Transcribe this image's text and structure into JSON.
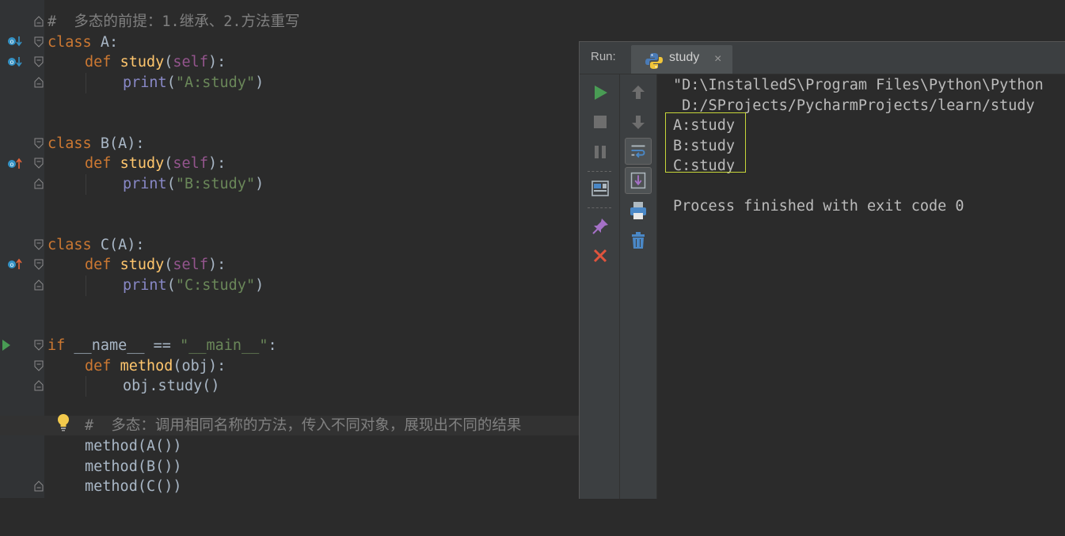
{
  "editor": {
    "lines": [
      {
        "comment": "#  多态的前提：1.继承、2.方法重写"
      },
      {
        "kw": "class",
        "name": " A:"
      },
      {
        "kw": "def",
        "fn": "study",
        "p1": "(",
        "self": "self",
        "p2": "):"
      },
      {
        "bi": "print",
        "p1": "(",
        "str": "\"A:study\"",
        "p2": ")"
      },
      {
        "kw": "class",
        "name": " B(A):"
      },
      {
        "kw": "def",
        "fn": "study",
        "p1": "(",
        "self": "self",
        "p2": "):"
      },
      {
        "bi": "print",
        "p1": "(",
        "str": "\"B:study\"",
        "p2": ")"
      },
      {
        "kw": "class",
        "name": " C(A):"
      },
      {
        "kw": "def",
        "fn": "study",
        "p1": "(",
        "self": "self",
        "p2": "):"
      },
      {
        "bi": "print",
        "p1": "(",
        "str": "\"C:study\"",
        "p2": ")"
      },
      {
        "kw": "if",
        "mid": " __name__ == ",
        "str": "\"__main__\"",
        "end": ":"
      },
      {
        "kw": "def",
        "fn": "method",
        "rest": "(obj):"
      },
      {
        "text": "obj.study()"
      },
      {
        "comment": "#  多态：调用相同名称的方法，传入不同对象，展现出不同的结果"
      },
      {
        "text": "method(A())"
      },
      {
        "text": "method(B())"
      },
      {
        "text": "method(C())"
      }
    ]
  },
  "run_panel": {
    "label": "Run:",
    "tab_name": "study",
    "tab_close": "×",
    "console_lines": [
      "\"D:\\InstalledS\\Program Files\\Python\\Python",
      " D:/SProjects/PycharmProjects/learn/study",
      "A:study",
      "B:study",
      "C:study",
      "",
      "Process finished with exit code 0"
    ]
  },
  "colors": {
    "keyword": "#cc7832",
    "function": "#ffc66d",
    "self": "#94558d",
    "string": "#6a8759",
    "builtin": "#8888c6",
    "comment": "#808080",
    "run_green": "#499c54",
    "highlight": "#c7d639"
  },
  "icons": {
    "gutter": [
      "override-down-icon",
      "override-up-icon",
      "run-gutter-icon",
      "lightbulb-icon"
    ],
    "toolbar": [
      "rerun-icon",
      "stop-icon",
      "pause-icon",
      "restore-layout-icon",
      "pin-icon",
      "close-icon",
      "up-arrow-icon",
      "down-arrow-icon",
      "soft-wrap-icon",
      "scroll-to-end-icon",
      "print-icon",
      "trash-icon"
    ]
  }
}
